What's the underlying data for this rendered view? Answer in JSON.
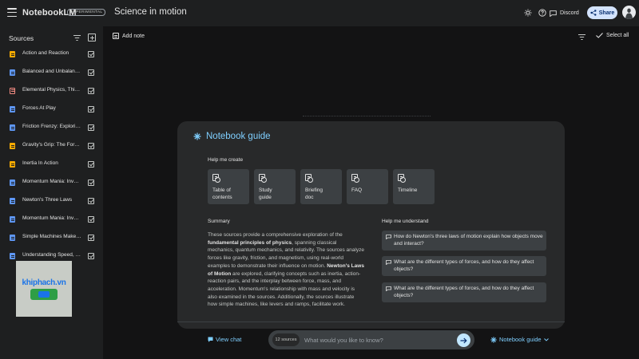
{
  "app": {
    "name": "NotebookLM",
    "badge": "EXPERIMENTAL",
    "notebook_title": "Science in motion",
    "discord_label": "Discord",
    "share_label": "Share"
  },
  "sidebar": {
    "title": "Sources",
    "sources": [
      {
        "label": "Action and Reaction",
        "type": "pdf"
      },
      {
        "label": "Balanced and Unbalanced Forces",
        "type": "doc"
      },
      {
        "label": "Elemental Physics, Third Edition",
        "type": "red"
      },
      {
        "label": "Forces At Play",
        "type": "doc"
      },
      {
        "label": "Friction Frenzy: Exploring Resistance",
        "type": "doc"
      },
      {
        "label": "Gravity's Grip: The Force That Binds",
        "type": "pdf"
      },
      {
        "label": "Inertia In Action",
        "type": "pdf"
      },
      {
        "label": "Momentum Mania: Investigating Motion",
        "type": "doc"
      },
      {
        "label": "Newton's Three Laws",
        "type": "doc"
      },
      {
        "label": "Momentum Mania: Investigating Impact",
        "type": "doc"
      },
      {
        "label": "Simple Machines Make Work Easier",
        "type": "doc"
      },
      {
        "label": "Understanding Speed, Velocity",
        "type": "doc"
      }
    ]
  },
  "watermark": {
    "text": "khiphach.vn"
  },
  "main": {
    "add_note_label": "Add note",
    "select_all_label": "Select all"
  },
  "guide": {
    "title": "Notebook guide",
    "help_create_label": "Help me create",
    "cards": [
      {
        "line1": "Table of",
        "line2": "contents"
      },
      {
        "line1": "Study",
        "line2": "guide"
      },
      {
        "line1": "Briefing",
        "line2": "doc"
      },
      {
        "line1": "FAQ",
        "line2": ""
      },
      {
        "line1": "Timeline",
        "line2": ""
      }
    ],
    "summary_label": "Summary",
    "summary": {
      "t1": "These sources provide a comprehensive exploration of the ",
      "b1": "fundamental principles of physics",
      "t2": ", spanning classical mechanics, quantum mechanics, and relativity. The sources analyze forces like gravity, friction, and magnetism, using real-world examples to demonstrate their influence on motion. ",
      "b2": "Newton's Laws of Motion",
      "t3": " are explored, clarifying concepts such as inertia, action-reaction pairs, and the interplay between force, mass, and acceleration. Momentum's relationship with mass and velocity is also examined in the sources. Additionally, the sources illustrate how simple machines, like levers and ramps, facilitate work."
    },
    "understand_label": "Help me understand",
    "questions": [
      "How do Newton's three laws of motion explain how objects move and interact?",
      "What are the different types of forces, and how do they affect objects?",
      "What are the different types of forces, and how do they affect objects?"
    ]
  },
  "chat": {
    "view_chat_label": "View chat",
    "sources_count": "12 sources",
    "placeholder": "What would you like to know?",
    "guide_button_label": "Notebook guide"
  },
  "colors": {
    "accent": "#7fcfff",
    "share_bg": "#d3e3fd",
    "send_bg": "#c2e7ff",
    "pdf_icon": "#f9ab00",
    "doc_icon": "#5e97f6",
    "red_icon": "#f28b82"
  }
}
